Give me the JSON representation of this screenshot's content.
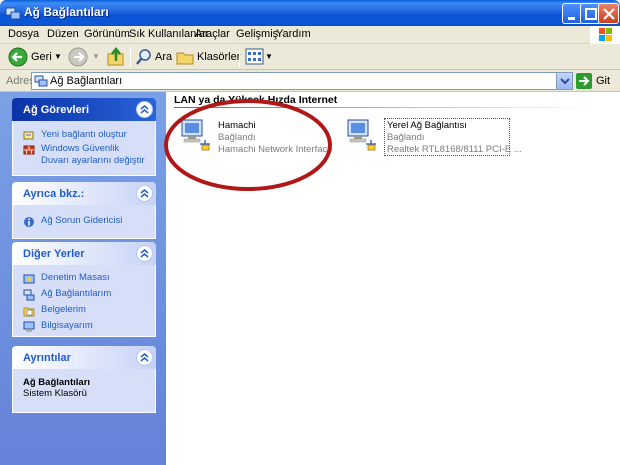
{
  "window": {
    "title": "Ağ Bağlantıları"
  },
  "menu": [
    "Dosya",
    "Düzen",
    "Görünüm",
    "Sık Kullanılanlar",
    "Araçlar",
    "Gelişmiş",
    "Yardım"
  ],
  "toolbar": {
    "back_label": "Geri",
    "search_label": "Ara",
    "folders_label": "Klasörler"
  },
  "address": {
    "label": "Adres",
    "value": "Ağ Bağlantıları",
    "go_label": "Git"
  },
  "left_panel": {
    "tasks": {
      "title": "Ağ Görevleri",
      "items": [
        "Yeni bağlantı oluştur",
        "Windows Güvenlik Duvarı ayarlarını değiştir"
      ]
    },
    "see_also": {
      "title": "Ayrıca bkz.:",
      "items": [
        "Ağ Sorun Gidericisi"
      ]
    },
    "other_places": {
      "title": "Diğer Yerler",
      "items": [
        "Denetim Masası",
        "Ağ Bağlantılarım",
        "Belgelerim",
        "Bilgisayarım"
      ]
    },
    "details": {
      "title": "Ayrıntılar",
      "name": "Ağ Bağlantıları",
      "type": "Sistem Klasörü"
    }
  },
  "content": {
    "group_header": "LAN ya da Yüksek Hızda Internet",
    "connections": [
      {
        "name": "Hamachi",
        "status": "Bağlandı",
        "device": "Hamachi Network Interface"
      },
      {
        "name": "Yerel Ağ Bağlantısı",
        "status": "Bağlandı",
        "device": "Realtek RTL8168/8111 PCI-E ..."
      }
    ]
  },
  "colors": {
    "title_bar": "#0a57d6",
    "left_pane": "#6f93e0",
    "panel_link": "#215dc6",
    "annotation_ring": "#b01818"
  }
}
